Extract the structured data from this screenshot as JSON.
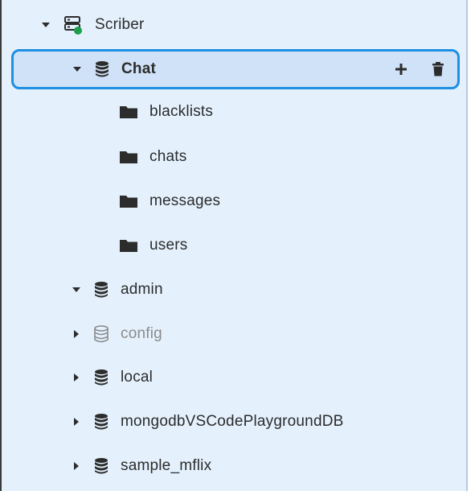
{
  "tree": {
    "connection": {
      "label": "Scriber",
      "icon": "server-connected-icon",
      "status_color": "#1e9e4a",
      "expanded": true
    },
    "databases": [
      {
        "label": "Chat",
        "icon": "database-icon",
        "expanded": true,
        "selected": true,
        "actions": {
          "add": "plus-icon",
          "delete": "trash-icon"
        },
        "collections": [
          {
            "label": "blacklists",
            "icon": "folder-icon"
          },
          {
            "label": "chats",
            "icon": "folder-icon"
          },
          {
            "label": "messages",
            "icon": "folder-icon"
          },
          {
            "label": "users",
            "icon": "folder-icon"
          }
        ]
      },
      {
        "label": "admin",
        "icon": "database-icon",
        "expanded": true
      },
      {
        "label": "config",
        "icon": "database-outline-icon",
        "expanded": false,
        "muted": true
      },
      {
        "label": "local",
        "icon": "database-icon",
        "expanded": false
      },
      {
        "label": "mongodbVSCodePlaygroundDB",
        "icon": "database-icon",
        "expanded": false
      },
      {
        "label": "sample_mflix",
        "icon": "database-icon",
        "expanded": false
      }
    ]
  },
  "colors": {
    "panel_background": "#e4f1fd",
    "selection_border": "#1e8fe1",
    "selection_background": "#cfe2f7",
    "text": "#2c2c2c",
    "muted_text": "#8a8a8a"
  }
}
